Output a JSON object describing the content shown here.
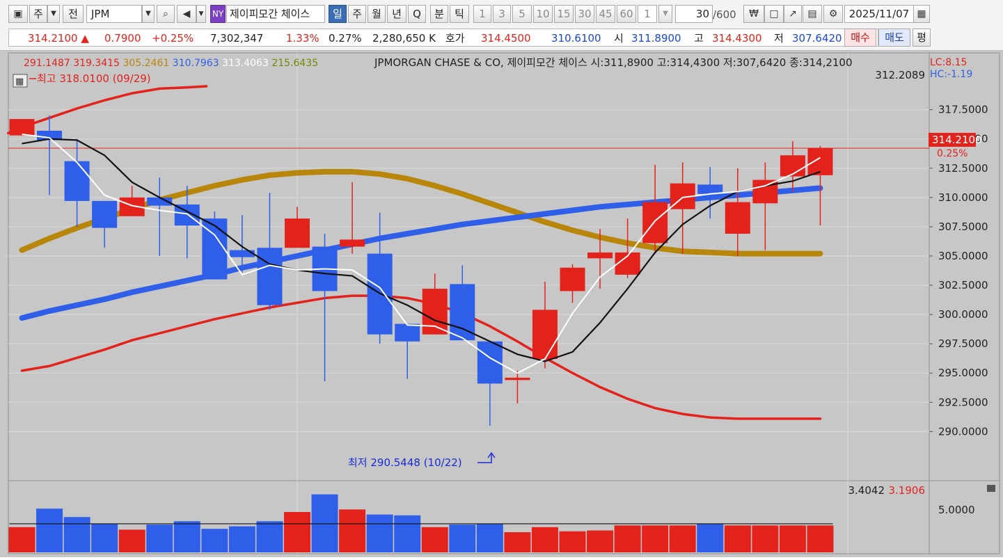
{
  "toolbar": {
    "period_label": "주",
    "currency_label": "전",
    "symbol": "JPM",
    "exchange_badge": "NY",
    "stock_name": "제이피모간 체이스",
    "period_tabs": [
      "일",
      "주",
      "월",
      "년",
      "Q",
      "분",
      "틱"
    ],
    "active_tab": "일",
    "interval_buttons": [
      "1",
      "3",
      "5",
      "10",
      "15",
      "30",
      "45",
      "60"
    ],
    "interval_value": "1",
    "count_value": "30",
    "count_max": "/600",
    "date": "2025/11/07"
  },
  "quote": {
    "price": "314.2100",
    "change": "0.7900",
    "change_pct": "+0.25%",
    "volume": "7,302,347",
    "turnover_pct": "1.33%",
    "ratio": "0.27%",
    "amount": "2,280,650 K",
    "bidask_label": "호가",
    "ask": "314.4500",
    "bid": "310.6100",
    "open_label": "시",
    "open": "311.8900",
    "high_label": "고",
    "high": "314.4300",
    "low_label": "저",
    "low": "307.6420",
    "buy_label": "매수",
    "sell_label": "매도",
    "eval_label": "평"
  },
  "legend": {
    "values": [
      {
        "text": "291.1487",
        "color": "#e3221c"
      },
      {
        "text": "319.3415",
        "color": "#e3221c"
      },
      {
        "text": "305.2461",
        "color": "#b8860b"
      },
      {
        "text": "310.7963",
        "color": "#2f5fe8"
      },
      {
        "text": "313.4063",
        "color": "#ffffff"
      },
      {
        "text": "215.6435",
        "color": "#6d8c00"
      }
    ],
    "title": "JPMORGAN CHASE & CO,  제이피모간 체이스 시:311,8900 고:314,4300 저:307,6420 종:314,2100",
    "lc": "LC:8.15",
    "hc": "HC:-1.19",
    "high_note": "최고 318.0100 (09/29)",
    "low_note": "최저 290.5448 (10/22)",
    "top_value": "312.2089",
    "current_price": "314.2100",
    "current_pct": "0.25%",
    "volume_values": [
      "3.4042",
      "3.1906"
    ],
    "volume_axis": "5.0000"
  },
  "chart_data": {
    "type": "candlestick",
    "ylim": [
      288.0,
      319.5
    ],
    "y_ticks": [
      "317.5000",
      "315.0000",
      "312.5000",
      "310.0000",
      "307.5000",
      "305.0000",
      "302.5000",
      "300.0000",
      "297.5000",
      "295.0000",
      "292.5000",
      "290.0000"
    ],
    "candles": [
      {
        "o": 315.3,
        "h": 316.7,
        "l": 315.3,
        "c": 316.7
      },
      {
        "o": 315.7,
        "h": 317.0,
        "l": 310.2,
        "c": 314.9
      },
      {
        "o": 313.1,
        "h": 315.0,
        "l": 307.5,
        "c": 309.7
      },
      {
        "o": 309.7,
        "h": 309.7,
        "l": 305.7,
        "c": 307.4
      },
      {
        "o": 308.4,
        "h": 311.0,
        "l": 308.4,
        "c": 310.0
      },
      {
        "o": 310.0,
        "h": 311.7,
        "l": 305.0,
        "c": 309.3
      },
      {
        "o": 309.4,
        "h": 311.0,
        "l": 304.8,
        "c": 307.6
      },
      {
        "o": 308.2,
        "h": 308.8,
        "l": 303.0,
        "c": 303.0
      },
      {
        "o": 305.5,
        "h": 308.5,
        "l": 303.6,
        "c": 304.9
      },
      {
        "o": 305.7,
        "h": 310.4,
        "l": 300.4,
        "c": 300.8
      },
      {
        "o": 305.7,
        "h": 309.2,
        "l": 305.7,
        "c": 308.2
      },
      {
        "o": 305.8,
        "h": 306.9,
        "l": 294.3,
        "c": 302.0
      },
      {
        "o": 305.8,
        "h": 311.3,
        "l": 305.2,
        "c": 306.4
      },
      {
        "o": 305.2,
        "h": 308.7,
        "l": 297.5,
        "c": 298.3
      },
      {
        "o": 299.2,
        "h": 299.2,
        "l": 294.5,
        "c": 297.7
      },
      {
        "o": 298.3,
        "h": 303.5,
        "l": 298.3,
        "c": 302.2
      },
      {
        "o": 302.6,
        "h": 304.2,
        "l": 298.1,
        "c": 297.8
      },
      {
        "o": 297.7,
        "h": 297.7,
        "l": 290.5,
        "c": 294.1
      },
      {
        "o": 294.4,
        "h": 295.2,
        "l": 292.4,
        "c": 294.6
      },
      {
        "o": 296.2,
        "h": 302.8,
        "l": 295.4,
        "c": 300.4
      },
      {
        "o": 302.0,
        "h": 304.3,
        "l": 301.0,
        "c": 304.0
      },
      {
        "o": 304.8,
        "h": 307.3,
        "l": 302.2,
        "c": 305.3
      },
      {
        "o": 303.4,
        "h": 308.2,
        "l": 303.1,
        "c": 305.3
      },
      {
        "o": 306.1,
        "h": 312.8,
        "l": 305.2,
        "c": 309.6
      },
      {
        "o": 309.0,
        "h": 313.0,
        "l": 305.2,
        "c": 311.2
      },
      {
        "o": 311.1,
        "h": 312.6,
        "l": 308.2,
        "c": 310.3
      },
      {
        "o": 306.9,
        "h": 312.5,
        "l": 305.0,
        "c": 309.6
      },
      {
        "o": 309.5,
        "h": 313.0,
        "l": 305.5,
        "c": 311.5
      },
      {
        "o": 311.8,
        "h": 314.8,
        "l": 310.5,
        "c": 313.6
      },
      {
        "o": 311.9,
        "h": 314.4,
        "l": 307.6,
        "c": 314.2
      }
    ],
    "ma_white": [
      315.4,
      315.1,
      313.0,
      310.2,
      309.3,
      308.9,
      308.6,
      306.8,
      303.4,
      304.2,
      303.8,
      303.9,
      303.8,
      302.3,
      299.1,
      299.0,
      298.0,
      296.3,
      295.0,
      296.2,
      300.1,
      303.2,
      305.0,
      308.0,
      310.0,
      310.3,
      310.5,
      311.0,
      312.0,
      313.4
    ],
    "ma_black": [
      314.6,
      315.0,
      314.9,
      313.6,
      311.3,
      310.0,
      308.8,
      307.6,
      305.8,
      304.3,
      303.8,
      303.5,
      303.3,
      301.8,
      300.8,
      299.5,
      298.8,
      297.7,
      296.6,
      296.0,
      296.8,
      299.3,
      302.2,
      305.3,
      307.7,
      309.3,
      310.5,
      311.0,
      311.4,
      312.2
    ],
    "bb_upper_x": [
      -0.5,
      0.0,
      1.0,
      2.0,
      3.0,
      4.0,
      5.0,
      6.0,
      6.7
    ],
    "bb_upper": [
      315.5,
      316.0,
      316.8,
      317.6,
      318.3,
      318.9,
      319.3,
      319.4,
      319.5
    ],
    "bb_lower": [
      295.2,
      295.6,
      296.3,
      297.0,
      297.8,
      298.4,
      299.0,
      299.6,
      300.1,
      300.6,
      301.0,
      301.4,
      301.6,
      301.6,
      301.4,
      300.9,
      300.1,
      299.0,
      297.7,
      296.3,
      295.0,
      293.8,
      292.8,
      292.0,
      291.5,
      291.2,
      291.1,
      291.1,
      291.1,
      291.1
    ],
    "trend_blue": [
      299.7,
      300.3,
      300.8,
      301.3,
      301.9,
      302.4,
      302.9,
      303.4,
      304.0,
      304.5,
      305.0,
      305.5,
      306.0,
      306.5,
      306.9,
      307.3,
      307.7,
      308.0,
      308.3,
      308.6,
      308.9,
      309.2,
      309.4,
      309.6,
      309.8,
      310.0,
      310.2,
      310.4,
      310.6,
      310.8
    ],
    "trend_gold": [
      305.5,
      306.5,
      307.4,
      308.2,
      309.0,
      309.8,
      310.4,
      311.0,
      311.5,
      311.9,
      312.1,
      312.2,
      312.2,
      312.0,
      311.6,
      311.0,
      310.3,
      309.5,
      308.7,
      307.9,
      307.2,
      306.6,
      306.1,
      305.7,
      305.4,
      305.3,
      305.2,
      305.2,
      305.2,
      305.2
    ],
    "volume": [
      3.0,
      5.2,
      4.2,
      3.4,
      2.7,
      3.3,
      3.7,
      2.8,
      3.1,
      3.7,
      4.8,
      6.9,
      5.1,
      4.5,
      4.4,
      3.0,
      3.3,
      3.4,
      2.4,
      3.0,
      2.5,
      2.6,
      3.2,
      3.2,
      3.2,
      3.4,
      3.2,
      3.2,
      3.2,
      3.2
    ],
    "volume_ma": 3.4,
    "volume_ylim": [
      0,
      7.2
    ]
  },
  "colors": {
    "up": "#e3221c",
    "down": "#2f5fe8",
    "chart_bg": "#c7c7c7"
  }
}
